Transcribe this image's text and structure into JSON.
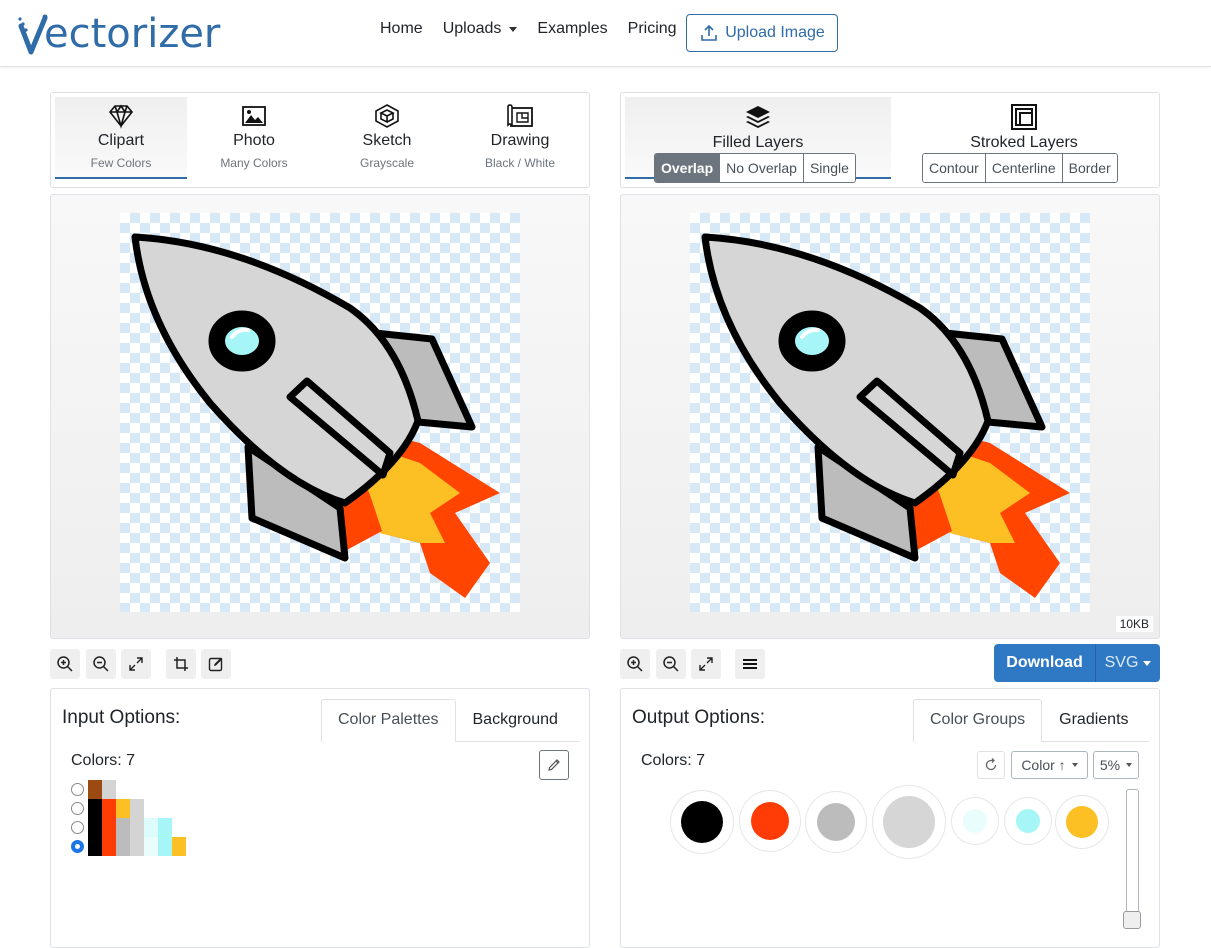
{
  "brand": {
    "name": "ectorizer",
    "logo_letter": "V"
  },
  "nav": {
    "home": "Home",
    "uploads": "Uploads",
    "examples": "Examples",
    "pricing": "Pricing",
    "upload_button": "Upload Image"
  },
  "input_modes": [
    {
      "title": "Clipart",
      "subtitle": "Few Colors",
      "active": true
    },
    {
      "title": "Photo",
      "subtitle": "Many Colors",
      "active": false
    },
    {
      "title": "Sketch",
      "subtitle": "Grayscale",
      "active": false
    },
    {
      "title": "Drawing",
      "subtitle": "Black / White",
      "active": false
    }
  ],
  "output_modes": {
    "filled": {
      "title": "Filled Layers",
      "options": [
        "Overlap",
        "No Overlap",
        "Single"
      ],
      "selected": "Overlap"
    },
    "stroked": {
      "title": "Stroked Layers",
      "options": [
        "Contour",
        "Centerline",
        "Border"
      ]
    }
  },
  "output_size": "10KB",
  "download": {
    "label": "Download",
    "format": "SVG"
  },
  "input_options": {
    "title": "Input Options:",
    "tabs": [
      "Color Palettes",
      "Background"
    ],
    "active_tab": "Color Palettes",
    "colors_label": "Colors: 7",
    "palettes": [
      {
        "selected": false,
        "colors": [
          "#9b4a12",
          "#d4d4d4"
        ]
      },
      {
        "selected": false,
        "colors": [
          "#000000",
          "#ff3c05",
          "#fcbf24",
          "#d4d4d4"
        ]
      },
      {
        "selected": false,
        "colors": [
          "#000000",
          "#ff3c05",
          "#bcbcbc",
          "#d4d4d4",
          "#ddfdfd",
          "#a6f6f8"
        ]
      },
      {
        "selected": true,
        "colors": [
          "#000000",
          "#ff3c05",
          "#bcbcbc",
          "#d4d4d4",
          "#eafdfd",
          "#a6f6f8",
          "#fcbf24"
        ]
      }
    ]
  },
  "output_options": {
    "title": "Output Options:",
    "tabs": [
      "Color Groups",
      "Gradients"
    ],
    "active_tab": "Color Groups",
    "colors_label": "Colors: 7",
    "sort_label": "Color ↑",
    "threshold_label": "5%",
    "color_groups": [
      "#000000",
      "#ff3c05",
      "#bcbcbc",
      "#d6d6d6",
      "#eafdfd",
      "#a6f6f8",
      "#fcbf24"
    ]
  },
  "colors": {
    "brand": "#2f6ca8",
    "download_bg": "#2f78c4"
  }
}
